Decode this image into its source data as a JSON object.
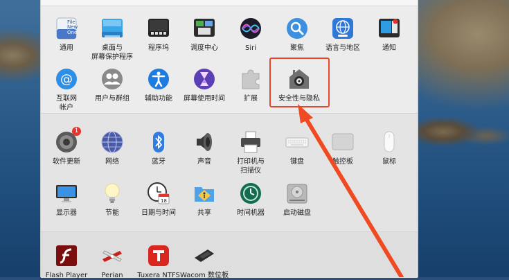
{
  "rows": {
    "row1": [
      {
        "id": "general",
        "label": "通用",
        "icon": "general-icon",
        "file_text": "File\nNew\nOne"
      },
      {
        "id": "desktop",
        "label": "桌面与\n屏幕保护程序",
        "icon": "desktop-screensaver-icon"
      },
      {
        "id": "dock",
        "label": "程序坞",
        "icon": "dock-icon"
      },
      {
        "id": "mission",
        "label": "调度中心",
        "icon": "mission-control-icon"
      },
      {
        "id": "siri",
        "label": "Siri",
        "icon": "siri-icon"
      },
      {
        "id": "spotlight",
        "label": "聚焦",
        "icon": "spotlight-icon"
      },
      {
        "id": "language",
        "label": "语言与地区",
        "icon": "language-region-icon"
      },
      {
        "id": "notify",
        "label": "通知",
        "icon": "notifications-icon"
      }
    ],
    "row2": [
      {
        "id": "internet",
        "label": "互联网\n帐户",
        "icon": "internet-accounts-icon"
      },
      {
        "id": "users",
        "label": "用户与群组",
        "icon": "users-groups-icon"
      },
      {
        "id": "access",
        "label": "辅助功能",
        "icon": "accessibility-icon"
      },
      {
        "id": "screentime",
        "label": "屏幕使用时间",
        "icon": "screen-time-icon"
      },
      {
        "id": "ext",
        "label": "扩展",
        "icon": "extensions-icon"
      },
      {
        "id": "security",
        "label": "安全性与隐私",
        "icon": "security-privacy-icon"
      }
    ],
    "row3": [
      {
        "id": "update",
        "label": "软件更新",
        "icon": "software-update-icon",
        "badge": "1"
      },
      {
        "id": "network",
        "label": "网络",
        "icon": "network-icon"
      },
      {
        "id": "bt",
        "label": "蓝牙",
        "icon": "bluetooth-icon"
      },
      {
        "id": "sound",
        "label": "声音",
        "icon": "sound-icon"
      },
      {
        "id": "printers",
        "label": "打印机与\n扫描仪",
        "icon": "printers-scanners-icon"
      },
      {
        "id": "keyboard",
        "label": "键盘",
        "icon": "keyboard-icon"
      },
      {
        "id": "trackpad",
        "label": "触控板",
        "icon": "trackpad-icon"
      },
      {
        "id": "mouse",
        "label": "鼠标",
        "icon": "mouse-icon"
      }
    ],
    "row4": [
      {
        "id": "display",
        "label": "显示器",
        "icon": "displays-icon"
      },
      {
        "id": "energy",
        "label": "节能",
        "icon": "energy-saver-icon"
      },
      {
        "id": "datetime",
        "label": "日期与时间",
        "icon": "date-time-icon",
        "date_text": "18"
      },
      {
        "id": "sharing",
        "label": "共享",
        "icon": "sharing-icon"
      },
      {
        "id": "tm",
        "label": "时间机器",
        "icon": "time-machine-icon"
      },
      {
        "id": "startup",
        "label": "启动磁盘",
        "icon": "startup-disk-icon"
      }
    ],
    "row5": [
      {
        "id": "flash",
        "label": "Flash Player",
        "icon": "flash-player-icon"
      },
      {
        "id": "perian",
        "label": "Perian",
        "icon": "perian-icon"
      },
      {
        "id": "tuxera",
        "label": "Tuxera NTFS",
        "icon": "tuxera-ntfs-icon"
      },
      {
        "id": "wacom",
        "label": "Wacom 数位板",
        "icon": "wacom-tablet-icon"
      }
    ]
  },
  "colors": {
    "highlight": "#e8452a",
    "arrow": "#f04a22"
  }
}
